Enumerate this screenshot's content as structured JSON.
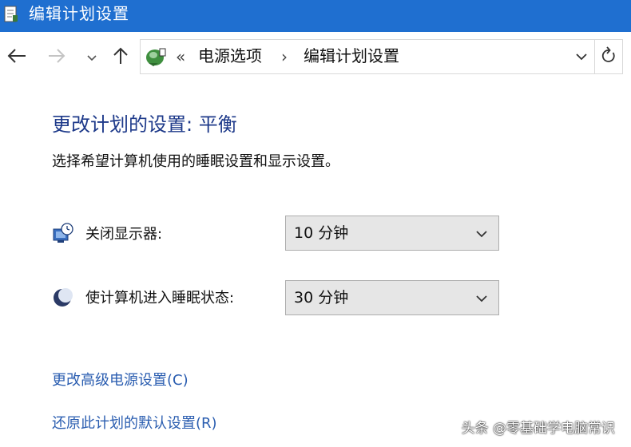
{
  "window": {
    "title": "编辑计划设置"
  },
  "nav": {
    "breadcrumb_prefix": "«",
    "breadcrumb": [
      "电源选项",
      "编辑计划设置"
    ],
    "separator": "›"
  },
  "main": {
    "title": "更改计划的设置: 平衡",
    "description": "选择希望计算机使用的睡眠设置和显示设置。",
    "settings": [
      {
        "label": "关闭显示器:",
        "value": "10 分钟"
      },
      {
        "label": "使计算机进入睡眠状态:",
        "value": "30 分钟"
      }
    ],
    "links": [
      "更改高级电源设置(C)",
      "还原此计划的默认设置(R)"
    ]
  },
  "watermark": "头条 @零基础学电脑常识",
  "colors": {
    "titlebar": "#1f6fd0",
    "title_text": "#1e3a8a",
    "link": "#2a5db0",
    "select_bg": "#e6e6e6"
  },
  "icons": {
    "app": "document-edit-icon",
    "back": "arrow-left-icon",
    "forward": "arrow-right-icon",
    "recent": "chevron-down-icon",
    "up": "arrow-up-icon",
    "location": "power-options-icon",
    "address_dropdown": "chevron-down-icon",
    "refresh": "refresh-icon",
    "display": "display-clock-icon",
    "sleep": "moon-icon"
  }
}
